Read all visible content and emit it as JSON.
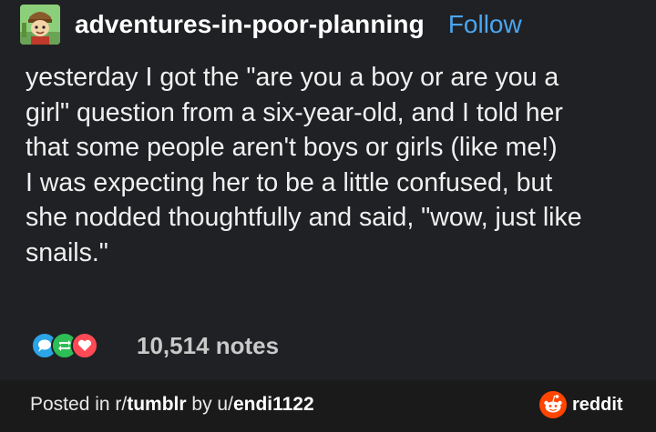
{
  "post": {
    "author": {
      "username": "adventures-in-poor-planning",
      "follow_label": "Follow",
      "avatar_icon": "cartoon-character-avatar-icon"
    },
    "body_lines": [
      "yesterday I got the \"are you a boy or are you a",
      "girl\" question from a six-year-old, and I told her",
      "that some people aren't boys or girls (like me!)",
      "I was expecting her to be a little confused, but",
      "she nodded thoughtfully and said, \"wow, just like",
      "snails.\""
    ],
    "notes": {
      "count_text": "10,514 notes",
      "icons": [
        "comment-icon",
        "reblog-icon",
        "heart-icon"
      ],
      "icon_colors": [
        "#2ba4e8",
        "#2dbe56",
        "#ff4a55"
      ]
    }
  },
  "footer": {
    "posted_prefix": "Posted in r/",
    "subreddit": "tumblr",
    "by_text": " by u/",
    "user": "endi1122",
    "reddit_label": "reddit",
    "reddit_icon": "reddit-alien-icon",
    "reddit_color": "#ff4500"
  },
  "colors": {
    "background": "#202124",
    "follow_link": "#4aa6f0",
    "footer_bg": "#1a1a1b"
  }
}
